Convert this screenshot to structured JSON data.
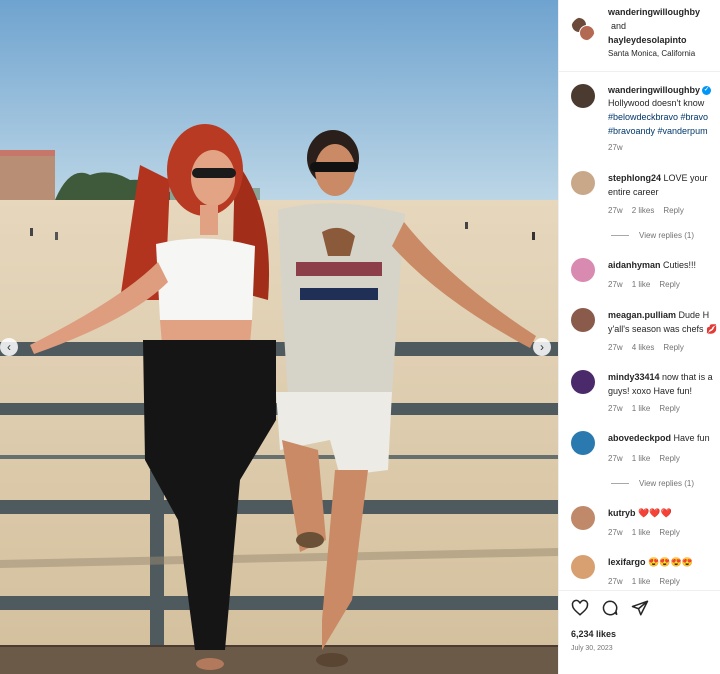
{
  "post": {
    "header": {
      "user1": "wanderingwilloughby",
      "and": "and",
      "user2": "hayleydesolapinto",
      "location": "Santa Monica, California"
    },
    "caption": {
      "user": "wanderingwilloughby",
      "text": "Hollywood doesn't know",
      "tags_line1": "#belowdeckbravo #bravo",
      "tags_line2": "#bravoandy #vanderpum",
      "time": "27w"
    },
    "comments": [
      {
        "user": "stephlong24",
        "text1": "LOVE your",
        "text2": "entire career",
        "time": "27w",
        "likes": "2 likes",
        "reply": "Reply",
        "view_replies": "View replies (1)",
        "avatar_color": "#c9a88a"
      },
      {
        "user": "aidanhyman",
        "text1": "Cuties!!!",
        "text2": "",
        "time": "27w",
        "likes": "1 like",
        "reply": "Reply",
        "avatar_color": "#d88ab0"
      },
      {
        "user": "meagan.pulliam",
        "text1": "Dude H",
        "text2": "y'all's season was chefs 💋",
        "time": "27w",
        "likes": "4 likes",
        "reply": "Reply",
        "avatar_color": "#8a5a4a"
      },
      {
        "user": "mindy33414",
        "text1": "now that is a",
        "text2": "guys! xoxo Have fun!",
        "time": "27w",
        "likes": "1 like",
        "reply": "Reply",
        "avatar_color": "#4a2a6a"
      },
      {
        "user": "abovedeckpod",
        "text1": "Have fun",
        "text2": "",
        "time": "27w",
        "likes": "1 like",
        "reply": "Reply",
        "view_replies": "View replies (1)",
        "avatar_color": "#2a7ab0"
      },
      {
        "user": "kutryb",
        "text1": "❤️❤️❤️",
        "text2": "",
        "time": "27w",
        "likes": "1 like",
        "reply": "Reply",
        "avatar_color": "#c08a6a"
      },
      {
        "user": "lexifargo",
        "text1": "😍😍😍😍",
        "text2": "",
        "time": "27w",
        "likes": "1 like",
        "reply": "Reply",
        "avatar_color": "#d8a070"
      }
    ],
    "likes": "6,234 likes",
    "date": "July 30, 2023",
    "icons": [
      "heart-icon",
      "comment-icon",
      "share-icon"
    ],
    "colors": {
      "link": "#00376b",
      "verified": "#0095f6",
      "muted": "#737373"
    }
  }
}
